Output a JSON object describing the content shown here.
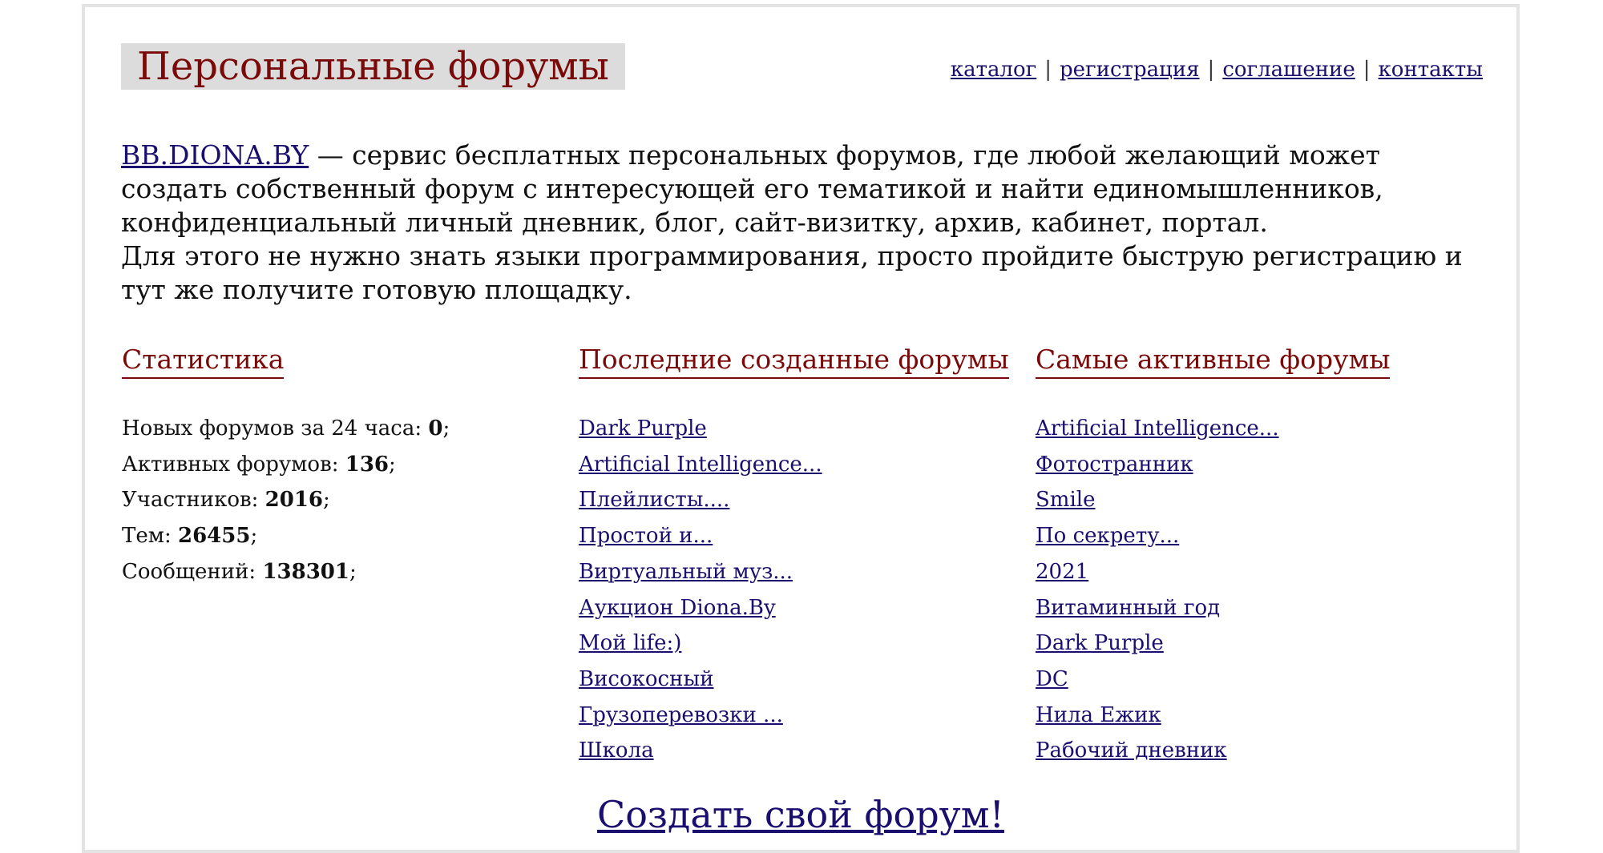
{
  "header": {
    "title": "Персональные форумы",
    "nav": [
      {
        "label": "каталог"
      },
      {
        "label": "регистрация"
      },
      {
        "label": "соглашение"
      },
      {
        "label": "контакты"
      }
    ],
    "nav_separator": "|"
  },
  "intro": {
    "site_link": "BB.DIONA.BY",
    "paragraph1_rest": " — сервис бесплатных персональных форумов, где любой желающий может создать собственный форум с интересующей его тематикой и найти единомышленников, конфиденциальный личный дневник, блог, сайт-визитку, архив, кабинет, портал.",
    "paragraph2": "Для этого не нужно знать языки программирования, просто пройдите быструю регистрацию и тут же получите готовую площадку."
  },
  "stats": {
    "heading": "Статистика",
    "items": [
      {
        "label": "Новых форумов за 24 часа: ",
        "value": "0",
        "suffix": ";"
      },
      {
        "label": "Активных форумов: ",
        "value": "136",
        "suffix": ";"
      },
      {
        "label": "Участников: ",
        "value": "2016",
        "suffix": ";"
      },
      {
        "label": "Тем: ",
        "value": "26455",
        "suffix": ";"
      },
      {
        "label": "Сообщений: ",
        "value": "138301",
        "suffix": ";"
      }
    ]
  },
  "latest": {
    "heading": "Последние созданные форумы",
    "items": [
      "Dark Purple",
      "Artificial Intelligence...",
      "Плейлисты....",
      "Простой и...",
      "Виртуальный муз...",
      "Аукцион Diona.By",
      "Мой life:)",
      "Високосный",
      "Грузоперевозки ...",
      "Школа"
    ]
  },
  "active": {
    "heading": "Самые активные форумы",
    "items": [
      "Artificial Intelligence...",
      "Фотостранник",
      "Smile",
      "По секрету...",
      "2021",
      "Витаминный год",
      "Dark Purple",
      "DC",
      "Нила Ежик",
      "Рабочий дневник"
    ]
  },
  "cta": {
    "label": "Создать свой форум!"
  },
  "colors": {
    "accent": "#7a0a0a",
    "link": "#1a0f6e",
    "title_bg": "#dcdcdc"
  }
}
